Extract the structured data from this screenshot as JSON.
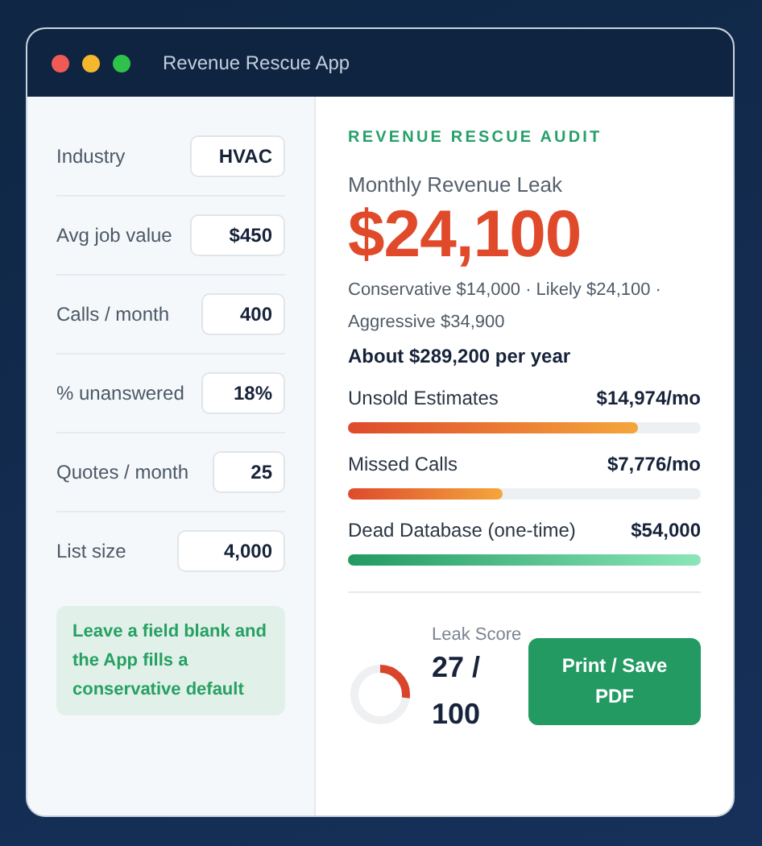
{
  "window": {
    "title": "Revenue Rescue App"
  },
  "inputs": [
    {
      "label": "Industry",
      "value": "HVAC"
    },
    {
      "label": "Avg job value",
      "value": "$450"
    },
    {
      "label": "Calls / month",
      "value": "400"
    },
    {
      "label": "% unanswered",
      "value": "18%"
    },
    {
      "label": "Quotes / month",
      "value": "25"
    },
    {
      "label": "List size",
      "value": "4,000"
    }
  ],
  "note": "Leave a field blank and the App fills a conservative default",
  "audit": {
    "heading": "REVENUE RESCUE AUDIT",
    "leak_label": "Monthly Revenue Leak",
    "leak_value": "$24,100",
    "range": "Conservative $14,000 · Likely $24,100 · Aggressive $34,900",
    "annual": "About $289,200 per year",
    "items": [
      {
        "label": "Unsold Estimates",
        "amount": "$14,974/mo",
        "level": 0.82,
        "kind": "recurring"
      },
      {
        "label": "Missed Calls",
        "amount": "$7,776/mo",
        "level": 0.44,
        "kind": "recurring"
      },
      {
        "label": "Dead Database (one-time)",
        "amount": "$54,000",
        "level": 1.0,
        "kind": "one-time"
      }
    ],
    "score": {
      "label": "Leak Score",
      "value": "27 / 100"
    },
    "button": "Print / Save PDF"
  }
}
